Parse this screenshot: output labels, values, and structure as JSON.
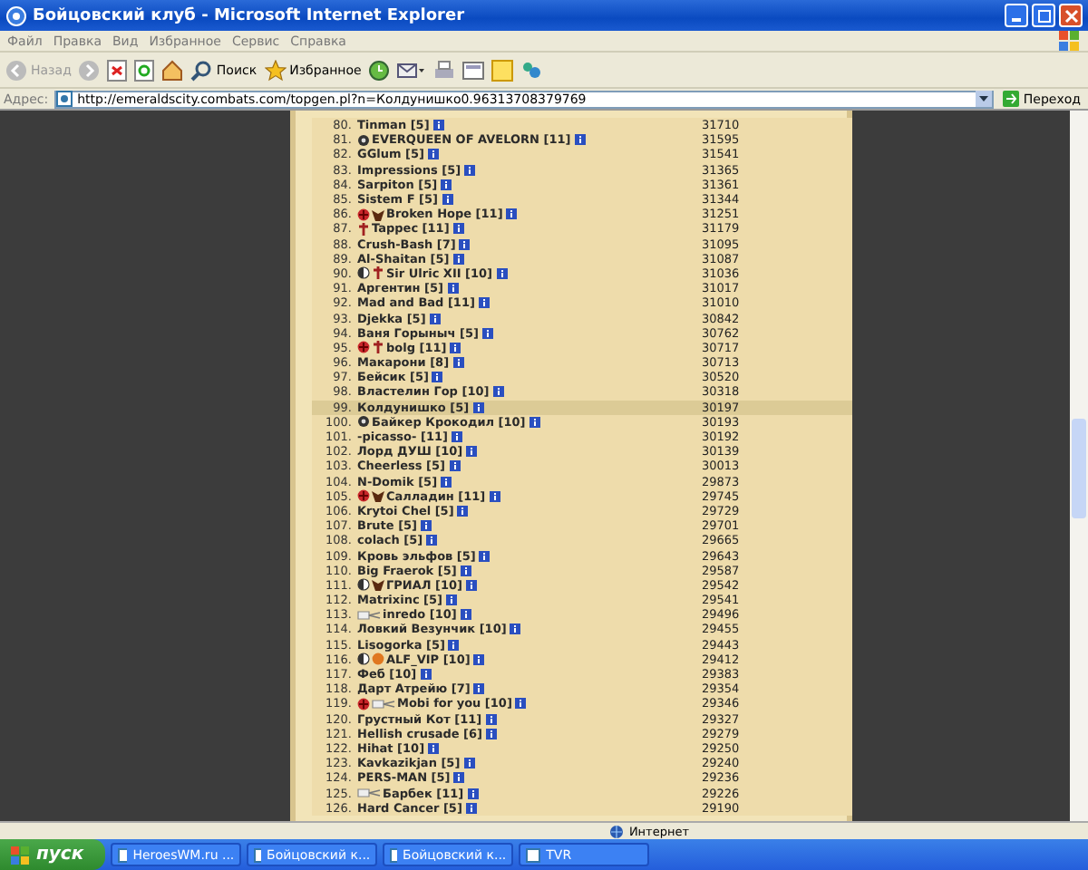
{
  "window": {
    "title": "Бойцовский клуб - Microsoft Internet Explorer"
  },
  "menu": [
    "Файл",
    "Правка",
    "Вид",
    "Избранное",
    "Сервис",
    "Справка"
  ],
  "toolbar": {
    "back": "Назад",
    "search": "Поиск",
    "favorites": "Избранное"
  },
  "address": {
    "label": "Адрес:",
    "value": "http://emeraldscity.combats.com/topgen.pl?n=Колдунишко0.96313708379769",
    "go": "Переход"
  },
  "rows": [
    {
      "rank": "80.",
      "name": "Tinman [5]",
      "score": "31710",
      "emblems": [],
      "selected": false
    },
    {
      "rank": "81.",
      "name": "EVERQUEEN OF AVELORN [11]",
      "score": "31595",
      "emblems": [
        {
          "kind": "dark"
        }
      ],
      "selected": false
    },
    {
      "rank": "82.",
      "name": "GGlum [5]",
      "score": "31541",
      "emblems": [],
      "selected": false
    },
    {
      "rank": "83.",
      "name": "Impressions [5]",
      "score": "31365",
      "emblems": [],
      "selected": false
    },
    {
      "rank": "84.",
      "name": "Sarpiton [5]",
      "score": "31361",
      "emblems": [],
      "selected": false
    },
    {
      "rank": "85.",
      "name": "Sistem F [5]",
      "score": "31344",
      "emblems": [],
      "selected": false
    },
    {
      "rank": "86.",
      "name": "Broken Hope [11]",
      "score": "31251",
      "emblems": [
        {
          "kind": "seal"
        },
        {
          "kind": "figure"
        }
      ],
      "selected": false
    },
    {
      "rank": "87.",
      "name": "Tappec [11]",
      "score": "31179",
      "emblems": [
        {
          "kind": "cross"
        }
      ],
      "selected": false
    },
    {
      "rank": "88.",
      "name": "Crush-Bash [7]",
      "score": "31095",
      "emblems": [],
      "selected": false
    },
    {
      "rank": "89.",
      "name": "Al-Shaitan [5]",
      "score": "31087",
      "emblems": [],
      "selected": false
    },
    {
      "rank": "90.",
      "name": "Sir Ulric XII [10]",
      "score": "31036",
      "emblems": [
        {
          "kind": "yin"
        },
        {
          "kind": "cross"
        }
      ],
      "selected": false
    },
    {
      "rank": "91.",
      "name": "Аргентин [5]",
      "score": "31017",
      "emblems": [],
      "selected": false
    },
    {
      "rank": "92.",
      "name": "Mad and Bad [11]",
      "score": "31010",
      "emblems": [],
      "selected": false
    },
    {
      "rank": "93.",
      "name": "Djekka [5]",
      "score": "30842",
      "emblems": [],
      "selected": false
    },
    {
      "rank": "94.",
      "name": "Ваня Горыныч [5]",
      "score": "30762",
      "emblems": [],
      "selected": false
    },
    {
      "rank": "95.",
      "name": "bolg [11]",
      "score": "30717",
      "emblems": [
        {
          "kind": "seal"
        },
        {
          "kind": "cross"
        }
      ],
      "selected": false
    },
    {
      "rank": "96.",
      "name": "Макарони [8]",
      "score": "30713",
      "emblems": [],
      "selected": false
    },
    {
      "rank": "97.",
      "name": "Бейсик [5]",
      "score": "30520",
      "emblems": [],
      "selected": false
    },
    {
      "rank": "98.",
      "name": "Властелин Гор [10]",
      "score": "30318",
      "emblems": [],
      "selected": false
    },
    {
      "rank": "99.",
      "name": "Колдунишко [5]",
      "score": "30197",
      "emblems": [],
      "selected": true
    },
    {
      "rank": "100.",
      "name": "Байкер Крокодил [10]",
      "score": "30193",
      "emblems": [
        {
          "kind": "dark"
        }
      ],
      "selected": false
    },
    {
      "rank": "101.",
      "name": "-picasso- [11]",
      "score": "30192",
      "emblems": [],
      "selected": false
    },
    {
      "rank": "102.",
      "name": "Лорд ДУШ [10]",
      "score": "30139",
      "emblems": [],
      "selected": false
    },
    {
      "rank": "103.",
      "name": "Cheerless [5]",
      "score": "30013",
      "emblems": [],
      "selected": false
    },
    {
      "rank": "104.",
      "name": "N-Domik [5]",
      "score": "29873",
      "emblems": [],
      "selected": false
    },
    {
      "rank": "105.",
      "name": "Салладин [11]",
      "score": "29745",
      "emblems": [
        {
          "kind": "seal"
        },
        {
          "kind": "figure"
        }
      ],
      "selected": false
    },
    {
      "rank": "106.",
      "name": "Krytoi Chel [5]",
      "score": "29729",
      "emblems": [],
      "selected": false
    },
    {
      "rank": "107.",
      "name": "Brute [5]",
      "score": "29701",
      "emblems": [],
      "selected": false
    },
    {
      "rank": "108.",
      "name": "colach [5]",
      "score": "29665",
      "emblems": [],
      "selected": false
    },
    {
      "rank": "109.",
      "name": "Кровь эльфов [5]",
      "score": "29643",
      "emblems": [],
      "selected": false
    },
    {
      "rank": "110.",
      "name": "Big Fraerok [5]",
      "score": "29587",
      "emblems": [],
      "selected": false
    },
    {
      "rank": "111.",
      "name": "ГРИАЛ [10]",
      "score": "29542",
      "emblems": [
        {
          "kind": "yin"
        },
        {
          "kind": "figure"
        }
      ],
      "selected": false
    },
    {
      "rank": "112.",
      "name": "Matrixinc [5]",
      "score": "29541",
      "emblems": [],
      "selected": false
    },
    {
      "rank": "113.",
      "name": "inredo [10]",
      "score": "29496",
      "emblems": [
        {
          "kind": "wings"
        }
      ],
      "selected": false
    },
    {
      "rank": "114.",
      "name": "Ловкий Везунчик [10]",
      "score": "29455",
      "emblems": [],
      "selected": false
    },
    {
      "rank": "115.",
      "name": "Lisogorka [5]",
      "score": "29443",
      "emblems": [],
      "selected": false
    },
    {
      "rank": "116.",
      "name": "ALF_VIP [10]",
      "score": "29412",
      "emblems": [
        {
          "kind": "yin"
        },
        {
          "kind": "sun"
        }
      ],
      "selected": false
    },
    {
      "rank": "117.",
      "name": "Феб [10]",
      "score": "29383",
      "emblems": [],
      "selected": false
    },
    {
      "rank": "118.",
      "name": "Дарт Атрейю [7]",
      "score": "29354",
      "emblems": [],
      "selected": false
    },
    {
      "rank": "119.",
      "name": "Mobi for you [10]",
      "score": "29346",
      "emblems": [
        {
          "kind": "seal"
        },
        {
          "kind": "wings"
        }
      ],
      "selected": false
    },
    {
      "rank": "120.",
      "name": "Грустный Кот [11]",
      "score": "29327",
      "emblems": [],
      "selected": false
    },
    {
      "rank": "121.",
      "name": "Hellish crusade [6]",
      "score": "29279",
      "emblems": [],
      "selected": false
    },
    {
      "rank": "122.",
      "name": "Hihat [10]",
      "score": "29250",
      "emblems": [],
      "selected": false
    },
    {
      "rank": "123.",
      "name": "Kavkazikjan [5]",
      "score": "29240",
      "emblems": [],
      "selected": false
    },
    {
      "rank": "124.",
      "name": "PERS-MAN [5]",
      "score": "29236",
      "emblems": [],
      "selected": false
    },
    {
      "rank": "125.",
      "name": "Барбек [11]",
      "score": "29226",
      "emblems": [
        {
          "kind": "wings"
        }
      ],
      "selected": false
    },
    {
      "rank": "126.",
      "name": "Hard Cancer [5]",
      "score": "29190",
      "emblems": [],
      "selected": false
    }
  ],
  "status_bar": {
    "zone": "Интернет"
  },
  "taskbar": {
    "start": "пуск",
    "tasks": [
      "HeroesWM.ru ...",
      "Бойцовский к...",
      "Бойцовский к...",
      "TVR"
    ]
  }
}
